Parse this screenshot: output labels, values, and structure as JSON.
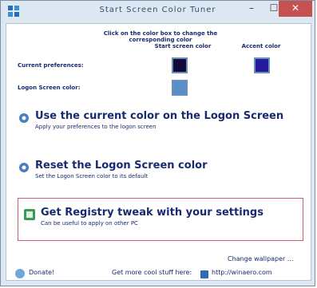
{
  "window": {
    "title": "Start Screen Color Tuner",
    "minimize_glyph": "–",
    "maximize_glyph": "☐",
    "close_glyph": "✕"
  },
  "columns": {
    "header": "Click on the color box to change the corresponding color",
    "bg_label": "Start screen color",
    "accent_label": "Accent color"
  },
  "rows": {
    "current_label": "Current preferences:",
    "logon_label": "Logon Screen color:"
  },
  "swatch_colors": {
    "current_bg": "#120a3a",
    "current_accent": "#241a9c",
    "logon": "#5a8ec8"
  },
  "options": [
    {
      "title": "Use the current color on the Logon Screen",
      "subtitle": "Apply your preferences to the logon screen"
    },
    {
      "title": "Reset the Logon Screen color",
      "subtitle": "Set the Logon Screen color to its default"
    },
    {
      "title": "Get Registry tweak with your settings",
      "subtitle": "Can be useful to apply on other PC"
    }
  ],
  "footer": {
    "change_wallpaper": "Change wallpaper ...",
    "donate": "Donate!",
    "tagline": "Get more cool stuff here:",
    "site": "http://winaero.com"
  }
}
